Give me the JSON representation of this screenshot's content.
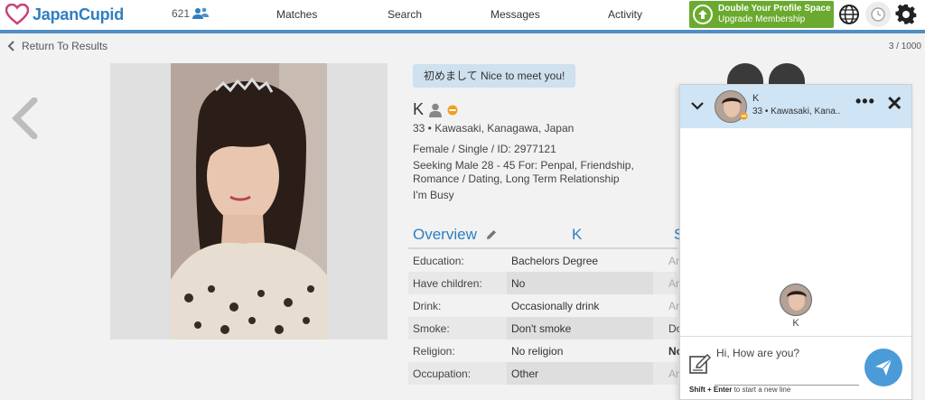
{
  "header": {
    "logo_text": "JapanCupid",
    "online_count": "621",
    "nav": [
      "Matches",
      "Search",
      "Messages",
      "Activity"
    ],
    "upgrade_line1": "Double Your Profile Space",
    "upgrade_line2": "Upgrade Membership",
    "accent_color": "#4f8fc6",
    "upgrade_color": "#6aab2f"
  },
  "subbar": {
    "return_label": "Return To Results",
    "counter": "3 / 1000"
  },
  "profile": {
    "greeting": "初めまして Nice to meet you!",
    "name": "K",
    "line1": "33 • Kawasaki, Kanagawa, Japan",
    "line2": "Female / Single / ID: 2977121",
    "line3": "Seeking Male 28 - 45 For: Penpal, Friendship,",
    "line4": "Romance / Dating, Long Term Relationship",
    "line5": "I'm Busy"
  },
  "overview": {
    "title": "Overview",
    "col_k": "K",
    "col_s": "S",
    "rows": [
      {
        "label": "Education:",
        "value": "Bachelors Degree",
        "extra": "An"
      },
      {
        "label": "Have children:",
        "value": "No",
        "extra": "An"
      },
      {
        "label": "Drink:",
        "value": "Occasionally drink",
        "extra": "An"
      },
      {
        "label": "Smoke:",
        "value": "Don't smoke",
        "extra": "Do"
      },
      {
        "label": "Religion:",
        "value": "No religion",
        "extra": "No"
      },
      {
        "label": "Occupation:",
        "value": "Other",
        "extra": "An"
      }
    ]
  },
  "chat": {
    "name": "K",
    "location": "33 • Kawasaki, Kana...",
    "dots": "•••",
    "close": "✕",
    "body_name": "K",
    "input_text": "Hi, How are you?",
    "hint_bold": "Shift + Enter",
    "hint_rest": " to start a new line"
  }
}
